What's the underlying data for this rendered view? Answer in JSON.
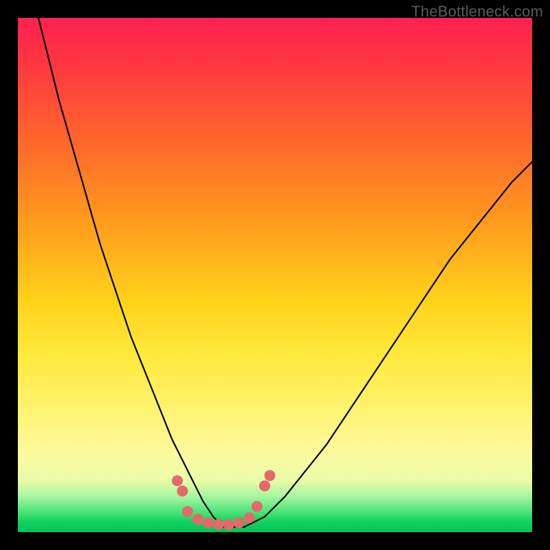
{
  "watermark": "TheBottleneck.com",
  "chart_data": {
    "type": "line",
    "title": "",
    "xlabel": "",
    "ylabel": "",
    "xlim": [
      0,
      100
    ],
    "ylim": [
      0,
      100
    ],
    "series": [
      {
        "name": "bottleneck-curve",
        "x": [
          4,
          6,
          8,
          10,
          12,
          14,
          16,
          18,
          20,
          22,
          24,
          26,
          28,
          30,
          32,
          34,
          36,
          38,
          40,
          44,
          48,
          52,
          56,
          60,
          64,
          68,
          72,
          76,
          80,
          84,
          88,
          92,
          96,
          100
        ],
        "y": [
          100,
          92,
          84,
          77,
          70,
          63,
          56,
          50,
          44,
          38,
          33,
          28,
          23,
          18,
          14,
          10,
          6,
          3,
          1,
          1,
          3,
          7,
          12,
          17,
          23,
          29,
          35,
          41,
          47,
          53,
          58,
          63,
          68,
          72
        ]
      }
    ],
    "markers": {
      "name": "highlight-points",
      "color": "#e46a6a",
      "points": [
        {
          "x": 31,
          "y": 10
        },
        {
          "x": 32,
          "y": 8
        },
        {
          "x": 33,
          "y": 4
        },
        {
          "x": 35,
          "y": 2.5
        },
        {
          "x": 37,
          "y": 1.8
        },
        {
          "x": 39,
          "y": 1.5
        },
        {
          "x": 41,
          "y": 1.5
        },
        {
          "x": 43,
          "y": 1.8
        },
        {
          "x": 45,
          "y": 2.8
        },
        {
          "x": 46.5,
          "y": 5
        },
        {
          "x": 48,
          "y": 9
        },
        {
          "x": 49,
          "y": 11
        }
      ]
    },
    "gradient_stops": [
      {
        "pos": 0,
        "color": "#ff2050"
      },
      {
        "pos": 55,
        "color": "#ffd21a"
      },
      {
        "pos": 100,
        "color": "#00c558"
      }
    ]
  }
}
